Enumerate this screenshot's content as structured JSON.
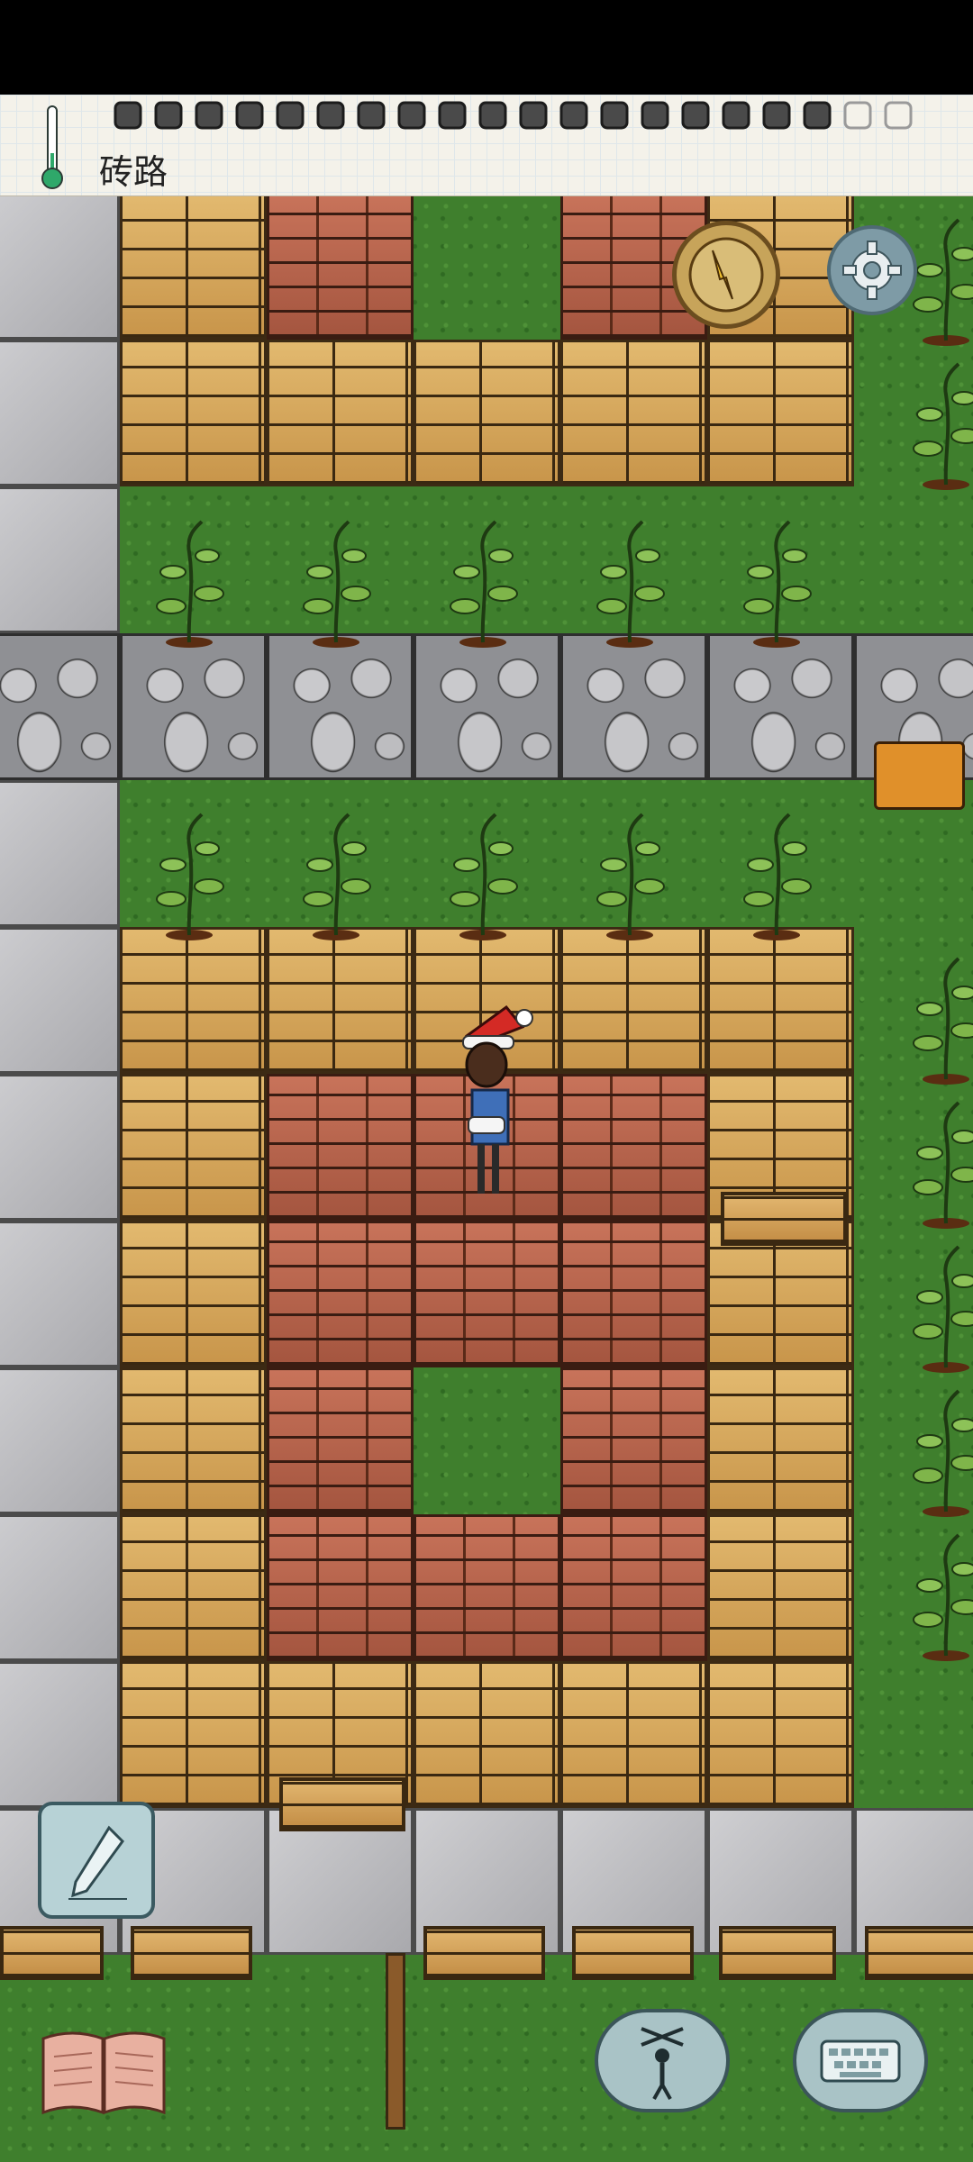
{
  "hud": {
    "tile_name": "砖路",
    "hunger_pips_total": 20,
    "hunger_pips_filled": 18,
    "temperature_level": 0.15
  },
  "buttons": {
    "settings_icon": "gear-icon",
    "compass_icon": "compass-icon",
    "edit_icon": "pencil-icon",
    "journal_icon": "book-icon",
    "emote_icon": "puppet-icon",
    "keyboard_icon": "keyboard-icon"
  },
  "colors": {
    "grass": "#3f7f2d",
    "wood_floor": "#d4a85e",
    "brick_floor": "#b5614a",
    "stone_floor": "#bcbcbf",
    "cobblestone": "#9fa0a4",
    "thermometer": "#2fa86a"
  },
  "character": {
    "hat": "santa-hat",
    "name": ""
  }
}
